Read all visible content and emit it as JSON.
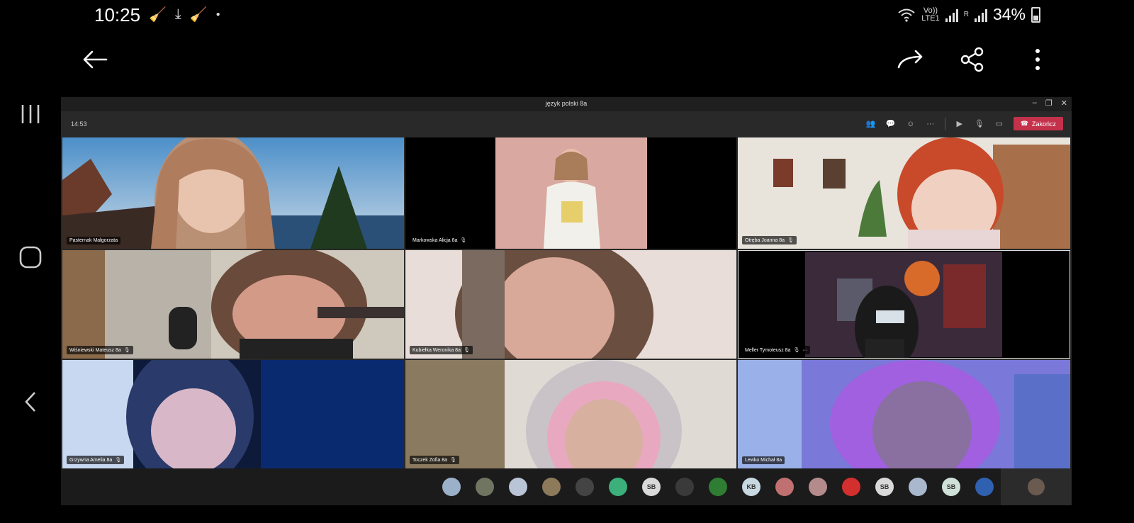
{
  "status_bar": {
    "time": "10:25",
    "network_top": "Vo))",
    "network_bottom": "LTE1",
    "roaming": "R",
    "battery": "34%"
  },
  "window": {
    "title": "język polski 8a",
    "meeting_time": "14:53",
    "end_call_label": "Zakończ"
  },
  "participants": [
    {
      "name": "Pasternak Małgorzata"
    },
    {
      "name": "Markowska Alicja 8a"
    },
    {
      "name": "Otręba Joanna 8a"
    },
    {
      "name": "Wiśniewski Mateusz 8a"
    },
    {
      "name": "Kubiełka Weronika 8a"
    },
    {
      "name": "Meller Tymoteusz 8a"
    },
    {
      "name": "Grzywna Amelia 8a"
    },
    {
      "name": "Toczek Zofia 8a"
    },
    {
      "name": "Lewko Michał 8a"
    }
  ],
  "avatars": [
    {
      "initials": "",
      "color": "#9bb0c9"
    },
    {
      "initials": "",
      "color": "#6f7560"
    },
    {
      "initials": "",
      "color": "#b9c4d6"
    },
    {
      "initials": "",
      "color": "#8c7a5a"
    },
    {
      "initials": "",
      "color": "#444444"
    },
    {
      "initials": "",
      "color": "#3bb07a"
    },
    {
      "initials": "SB",
      "color": "#d9d9d9"
    },
    {
      "initials": "",
      "color": "#3a3a3a"
    },
    {
      "initials": "",
      "color": "#2e7d32"
    },
    {
      "initials": "KB",
      "color": "#c8d8e0"
    },
    {
      "initials": "",
      "color": "#c07070"
    },
    {
      "initials": "",
      "color": "#b48a8a"
    },
    {
      "initials": "",
      "color": "#d32f2f"
    },
    {
      "initials": "SB",
      "color": "#d9d9d9"
    },
    {
      "initials": "",
      "color": "#a9b8cc"
    },
    {
      "initials": "SB",
      "color": "#cfe0d8"
    },
    {
      "initials": "",
      "color": "#3060b0"
    }
  ]
}
